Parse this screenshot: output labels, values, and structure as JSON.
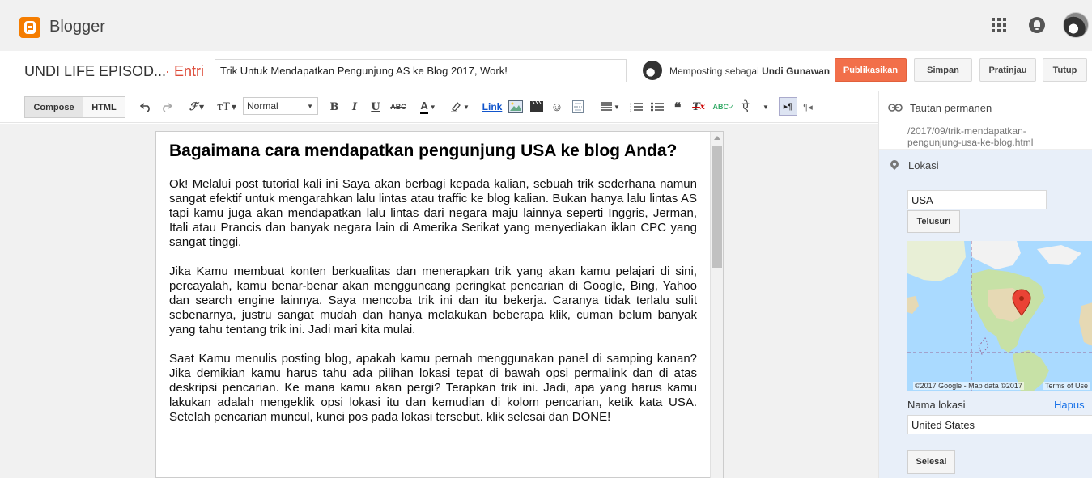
{
  "app": {
    "brand": "Blogger"
  },
  "header": {
    "blog_name": "UNDI LIFE EPISOD...",
    "crumb": "· Entri"
  },
  "post": {
    "title": "Trik Untuk Mendapatkan Pengunjung AS ke Blog 2017, Work!",
    "author_prefix": "Memposting sebagai",
    "author_name": "Undi Gunawan"
  },
  "actions": {
    "publish": "Publikasikan",
    "save": "Simpan",
    "preview": "Pratinjau",
    "close": "Tutup"
  },
  "toolbar": {
    "compose": "Compose",
    "html": "HTML",
    "format": "Normal",
    "link": "Link"
  },
  "content": {
    "heading": "Bagaimana cara mendapatkan pengunjung USA ke blog Anda?",
    "paragraphs": [
      "Ok! Melalui post tutorial kali ini Saya akan berbagi kepada kalian, sebuah trik sederhana namun sangat efektif untuk mengarahkan lalu lintas atau traffic ke blog kalian. Bukan hanya lalu lintas AS tapi kamu juga akan mendapatkan lalu lintas dari negara maju lainnya seperti Inggris, Jerman, Itali atau Prancis dan banyak negara lain di Amerika Serikat yang menyediakan iklan CPC yang sangat tinggi.",
      "Jika Kamu membuat konten berkualitas dan menerapkan trik yang akan kamu pelajari di sini, percayalah, kamu benar-benar akan mengguncang peringkat pencarian di Google, Bing, Yahoo dan search engine lainnya. Saya mencoba trik ini dan itu bekerja. Caranya tidak terlalu sulit sebenarnya, justru sangat mudah dan hanya melakukan beberapa klik, cuman belum banyak yang tahu tentang trik ini. Jadi mari kita mulai.",
      "Saat Kamu menulis posting blog, apakah kamu pernah menggunakan panel di samping kanan? Jika demikian kamu harus tahu ada pilihan lokasi tepat di bawah opsi permalink dan di atas deskripsi pencarian. Ke mana kamu akan pergi? Terapkan trik ini. Jadi, apa yang harus kamu lakukan adalah mengeklik opsi lokasi itu dan kemudian di kolom pencarian, ketik kata USA. Setelah pencarian muncul, kunci pos pada lokasi tersebut. klik selesai dan DONE!"
    ]
  },
  "sidebar": {
    "permalink_title": "Tautan permanen",
    "permalink_url": "/2017/09/trik-mendapatkan-pengunjung-usa-ke-blog.html",
    "location_title": "Lokasi",
    "search_value": "USA",
    "search_button": "Telusuri",
    "map_attribution": "©2017 Google - Map data ©2017",
    "map_terms": "Terms of Use",
    "location_name_label": "Nama lokasi",
    "delete_link": "Hapus",
    "location_name_value": "United States",
    "done_button": "Selesai"
  },
  "colors": {
    "brand_orange": "#f57d00",
    "publish": "#f26f4a",
    "link_blue": "#1155cc",
    "panel_blue": "#e8eff9",
    "map_water": "#aadaff",
    "marker": "#ea4335"
  }
}
